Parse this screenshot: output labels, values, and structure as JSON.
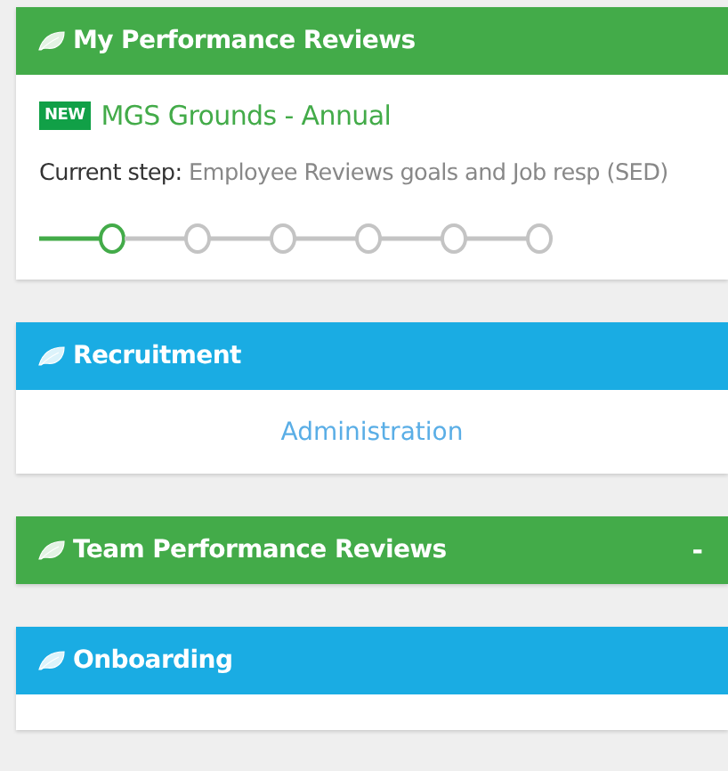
{
  "panels": [
    {
      "kind": "review",
      "title": "My Performance Reviews",
      "color": "#43ab49",
      "badge": "NEW",
      "review_title": "MGS Grounds - Annual",
      "step_label": "Current step:",
      "step_value": "Employee Reviews goals and Job resp (SED)",
      "steps": [
        {
          "current": true
        },
        {
          "current": false
        },
        {
          "current": false
        },
        {
          "current": false
        },
        {
          "current": false
        },
        {
          "current": false
        }
      ]
    },
    {
      "kind": "links",
      "title": "Recruitment",
      "color": "#1aace3",
      "links": [
        "Administration"
      ]
    },
    {
      "kind": "collapsed",
      "title": "Team Performance Reviews",
      "color": "#43ab49",
      "toggle": "-"
    },
    {
      "kind": "open",
      "title": "Onboarding",
      "color": "#1aace3"
    }
  ]
}
